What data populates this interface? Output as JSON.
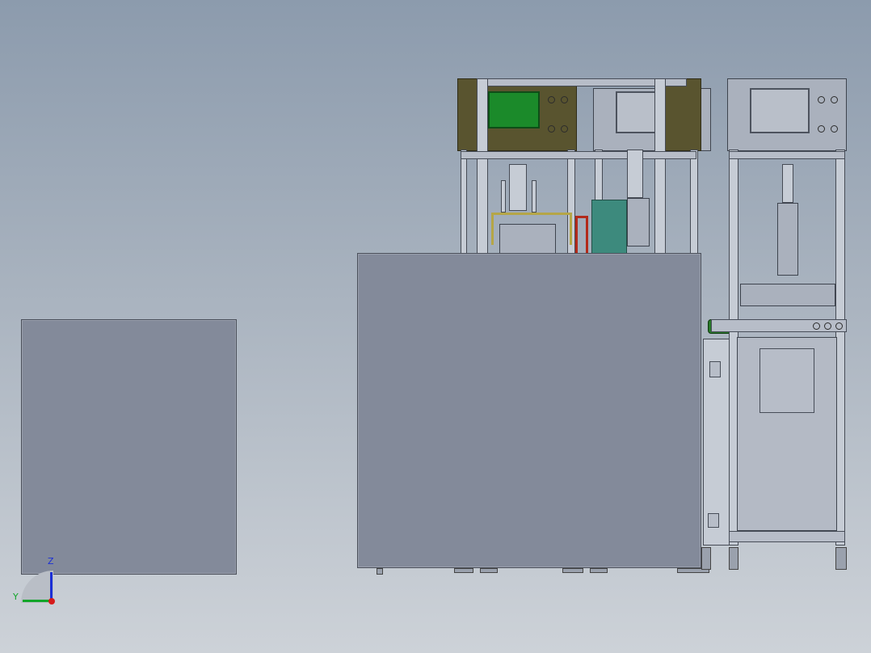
{
  "viewport": {
    "background_top": "#8c9bad",
    "background_bottom": "#cdd2d8"
  },
  "model": {
    "panel_color": "#838a9a",
    "screen_color": "#1b8a2a",
    "olive_color": "#59542f",
    "accent_teal": "#3d8a7d",
    "accent_red": "#b22a1a",
    "accent_yellow": "#b5a647"
  },
  "triad": {
    "z_label": "Z",
    "y_label": "Y",
    "z_color": "#1b2fd6",
    "y_color": "#12a52a",
    "x_color": "#d61b1b"
  }
}
